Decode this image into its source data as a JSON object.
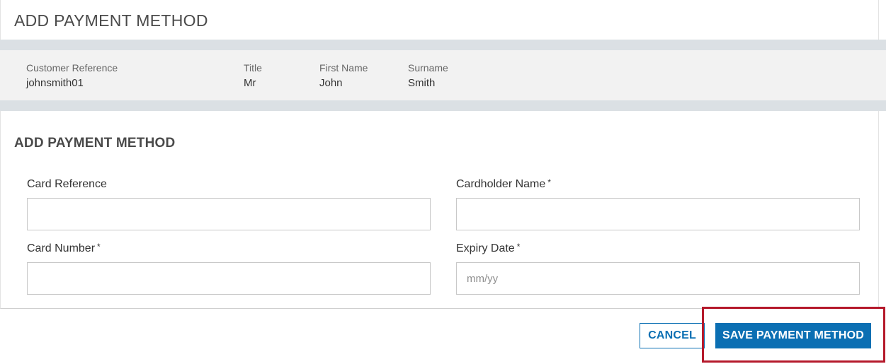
{
  "header": {
    "title": "ADD PAYMENT METHOD"
  },
  "customer": {
    "reference_label": "Customer Reference",
    "reference_value": "johnsmith01",
    "title_label": "Title",
    "title_value": "Mr",
    "first_name_label": "First Name",
    "first_name_value": "John",
    "surname_label": "Surname",
    "surname_value": "Smith"
  },
  "form": {
    "section_title": "ADD PAYMENT METHOD",
    "required_marker": "*",
    "card_reference": {
      "label": "Card Reference",
      "value": "",
      "placeholder": ""
    },
    "cardholder_name": {
      "label": "Cardholder Name",
      "value": "",
      "placeholder": ""
    },
    "card_number": {
      "label": "Card Number",
      "value": "",
      "placeholder": ""
    },
    "expiry_date": {
      "label": "Expiry Date",
      "value": "",
      "placeholder": "mm/yy"
    }
  },
  "actions": {
    "cancel_label": "CANCEL",
    "save_label": "SAVE PAYMENT METHOD"
  },
  "colors": {
    "primary": "#0b6fb3",
    "highlight": "#b5192b",
    "band": "#dbe0e4",
    "strip": "#f2f2f2"
  }
}
